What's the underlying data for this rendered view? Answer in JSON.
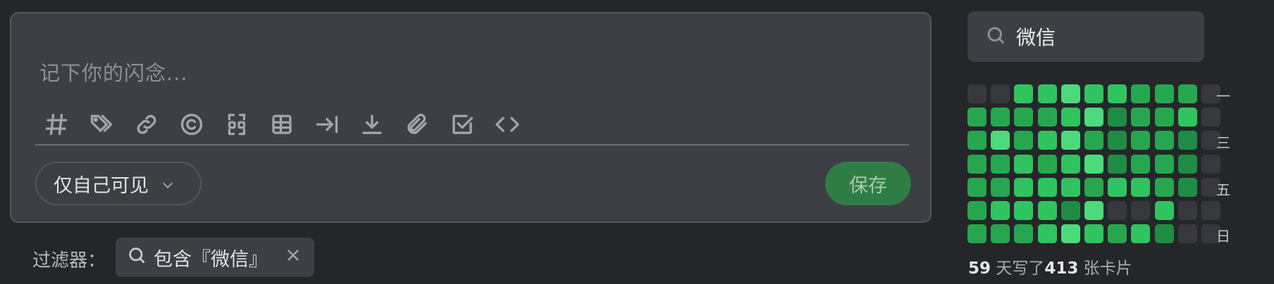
{
  "editor": {
    "placeholder": "记下你的闪念...",
    "toolbar": [
      {
        "name": "hashtag-icon"
      },
      {
        "name": "tags-icon"
      },
      {
        "name": "link-icon"
      },
      {
        "name": "copyright-icon"
      },
      {
        "name": "scan-icon"
      },
      {
        "name": "table-icon"
      },
      {
        "name": "indent-icon"
      },
      {
        "name": "download-icon"
      },
      {
        "name": "paperclip-icon"
      },
      {
        "name": "checkbox-icon"
      },
      {
        "name": "code-icon"
      }
    ],
    "visibility_label": "仅自己可见",
    "save_label": "保存",
    "colors": {
      "save_bg": "#2f7d45",
      "card_bg": "#3d3f44"
    }
  },
  "filter": {
    "label": "过滤器：",
    "chip_text": "包含『微信』"
  },
  "sidebar": {
    "search_value": "微信",
    "weekday_labels": {
      "mon": "一",
      "wed": "三",
      "fri": "五",
      "sun": "日"
    },
    "stats": {
      "days": "59",
      "days_text": " 天写了",
      "cards": "413",
      "cards_text": " 张卡片"
    },
    "heatmap": {
      "colors": {
        "empty": "#36383d",
        "l1": "#1e6b38",
        "l2": "#1f8c44",
        "l3": "#26a74f",
        "l4": "#2fc45f",
        "l5": "#4cdb7c"
      },
      "levels": [
        [
          "empty",
          "l3",
          "l3",
          "l3",
          "l3",
          "l3",
          "l3"
        ],
        [
          "empty",
          "l3",
          "l5",
          "l3",
          "l3",
          "l4",
          "l3"
        ],
        [
          "l4",
          "l3",
          "l3",
          "l4",
          "l4",
          "l4",
          "l3"
        ],
        [
          "l4",
          "l3",
          "l4",
          "l3",
          "l4",
          "l4",
          "l4"
        ],
        [
          "l5",
          "l4",
          "l5",
          "l4",
          "l4",
          "l2",
          "l5"
        ],
        [
          "l4",
          "l5",
          "l3",
          "l5",
          "l3",
          "l5",
          "l4"
        ],
        [
          "l4",
          "l2",
          "l2",
          "l2",
          "l4",
          "empty",
          "l3"
        ],
        [
          "l3",
          "l3",
          "l3",
          "l3",
          "l4",
          "empty",
          "l4"
        ],
        [
          "l3",
          "l3",
          "l3",
          "l3",
          "l3",
          "l4",
          "l2"
        ],
        [
          "l3",
          "l4",
          "l2",
          "l2",
          "l2",
          "empty",
          "empty"
        ],
        [
          "empty",
          "empty",
          "empty",
          "empty",
          "empty",
          "empty",
          "empty"
        ]
      ]
    }
  }
}
